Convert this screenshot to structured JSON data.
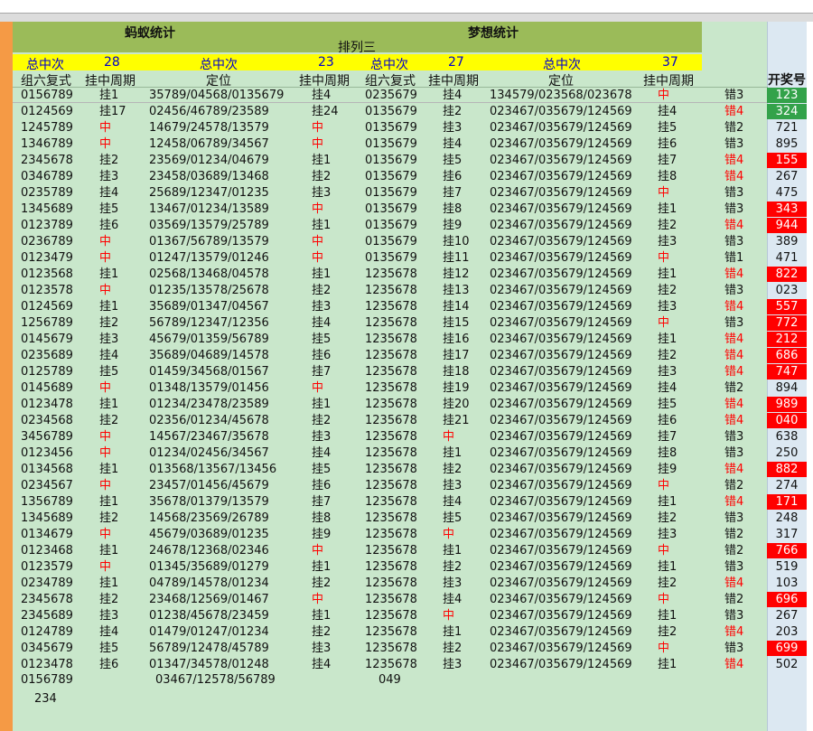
{
  "header": {
    "title_left": "蚂蚁统计",
    "title_right": "梦想统计",
    "subtitle": "排列三",
    "yellow": [
      "总中次",
      "28",
      "总中次",
      "23",
      "总中次",
      "27",
      "总中次",
      "37"
    ],
    "cols": [
      "组六复式",
      "挂中周期",
      "定位",
      "挂中周期",
      "组六复式",
      "挂中周期",
      "定位",
      "挂中周期"
    ],
    "award_header": "开奖号"
  },
  "rows": [
    {
      "a1": "0156789",
      "a2": "挂1",
      "a3": "35789/04568/0135679",
      "b0": "挂4",
      "b1": "0235679",
      "b2": "挂4",
      "b3": "134579/023568/023678",
      "b4": "中",
      "e": "错3",
      "aw": "123",
      "awc": "green"
    },
    {
      "a1": "0124569",
      "a2": "挂17",
      "a3": "02456/46789/23589",
      "b0": "挂24",
      "b1": "0135679",
      "b2": "挂2",
      "b3": "023467/035679/124569",
      "b4": "挂4",
      "e": "错4",
      "aw": "324",
      "awc": "green"
    },
    {
      "a1": "1245789",
      "a2": "中",
      "a3": "14679/24578/13579",
      "b0": "中",
      "b1": "0135679",
      "b2": "挂3",
      "b3": "023467/035679/124569",
      "b4": "挂5",
      "e": "错2",
      "aw": "721",
      "awc": ""
    },
    {
      "a1": "1346789",
      "a2": "中",
      "a3": "12458/06789/34567",
      "b0": "中",
      "b1": "0135679",
      "b2": "挂4",
      "b3": "023467/035679/124569",
      "b4": "挂6",
      "e": "错3",
      "aw": "895",
      "awc": ""
    },
    {
      "a1": "2345678",
      "a2": "挂2",
      "a3": "23569/01234/04679",
      "b0": "挂1",
      "b1": "0135679",
      "b2": "挂5",
      "b3": "023467/035679/124569",
      "b4": "挂7",
      "e": "错4",
      "aw": "155",
      "awc": "red"
    },
    {
      "a1": "0346789",
      "a2": "挂3",
      "a3": "23458/03689/13468",
      "b0": "挂2",
      "b1": "0135679",
      "b2": "挂6",
      "b3": "023467/035679/124569",
      "b4": "挂8",
      "e": "错4",
      "aw": "267",
      "awc": ""
    },
    {
      "a1": "0235789",
      "a2": "挂4",
      "a3": "25689/12347/01235",
      "b0": "挂3",
      "b1": "0135679",
      "b2": "挂7",
      "b3": "023467/035679/124569",
      "b4": "中",
      "e": "错3",
      "aw": "475",
      "awc": ""
    },
    {
      "a1": "1345689",
      "a2": "挂5",
      "a3": "13467/01234/13589",
      "b0": "中",
      "b1": "0135679",
      "b2": "挂8",
      "b3": "023467/035679/124569",
      "b4": "挂1",
      "e": "错3",
      "aw": "343",
      "awc": "red"
    },
    {
      "a1": "0123789",
      "a2": "挂6",
      "a3": "03569/13579/25789",
      "b0": "挂1",
      "b1": "0135679",
      "b2": "挂9",
      "b3": "023467/035679/124569",
      "b4": "挂2",
      "e": "错4",
      "aw": "944",
      "awc": "red"
    },
    {
      "a1": "0236789",
      "a2": "中",
      "a3": "01367/56789/13579",
      "b0": "中",
      "b1": "0135679",
      "b2": "挂10",
      "b3": "023467/035679/124569",
      "b4": "挂3",
      "e": "错3",
      "aw": "389",
      "awc": ""
    },
    {
      "a1": "0123479",
      "a2": "中",
      "a3": "01247/13579/01246",
      "b0": "中",
      "b1": "0135679",
      "b2": "挂11",
      "b3": "023467/035679/124569",
      "b4": "中",
      "e": "错1",
      "aw": "471",
      "awc": ""
    },
    {
      "a1": "0123568",
      "a2": "挂1",
      "a3": "02568/13468/04578",
      "b0": "挂1",
      "b1": "1235678",
      "b2": "挂12",
      "b3": "023467/035679/124569",
      "b4": "挂1",
      "e": "错4",
      "aw": "822",
      "awc": "red"
    },
    {
      "a1": "0123578",
      "a2": "中",
      "a3": "01235/13578/25678",
      "b0": "挂2",
      "b1": "1235678",
      "b2": "挂13",
      "b3": "023467/035679/124569",
      "b4": "挂2",
      "e": "错3",
      "aw": "023",
      "awc": ""
    },
    {
      "a1": "0124569",
      "a2": "挂1",
      "a3": "35689/01347/04567",
      "b0": "挂3",
      "b1": "1235678",
      "b2": "挂14",
      "b3": "023467/035679/124569",
      "b4": "挂3",
      "e": "错4",
      "aw": "557",
      "awc": "red"
    },
    {
      "a1": "1256789",
      "a2": "挂2",
      "a3": "56789/12347/12356",
      "b0": "挂4",
      "b1": "1235678",
      "b2": "挂15",
      "b3": "023467/035679/124569",
      "b4": "中",
      "e": "错3",
      "aw": "772",
      "awc": "red"
    },
    {
      "a1": "0145679",
      "a2": "挂3",
      "a3": "45679/01359/56789",
      "b0": "挂5",
      "b1": "1235678",
      "b2": "挂16",
      "b3": "023467/035679/124569",
      "b4": "挂1",
      "e": "错4",
      "aw": "212",
      "awc": "red"
    },
    {
      "a1": "0235689",
      "a2": "挂4",
      "a3": "35689/04689/14578",
      "b0": "挂6",
      "b1": "1235678",
      "b2": "挂17",
      "b3": "023467/035679/124569",
      "b4": "挂2",
      "e": "错4",
      "aw": "686",
      "awc": "red"
    },
    {
      "a1": "0125789",
      "a2": "挂5",
      "a3": "01459/34568/01567",
      "b0": "挂7",
      "b1": "1235678",
      "b2": "挂18",
      "b3": "023467/035679/124569",
      "b4": "挂3",
      "e": "错4",
      "aw": "747",
      "awc": "red"
    },
    {
      "a1": "0145689",
      "a2": "中",
      "a3": "01348/13579/01456",
      "b0": "中",
      "b1": "1235678",
      "b2": "挂19",
      "b3": "023467/035679/124569",
      "b4": "挂4",
      "e": "错2",
      "aw": "894",
      "awc": ""
    },
    {
      "a1": "0123478",
      "a2": "挂1",
      "a3": "01234/23478/23589",
      "b0": "挂1",
      "b1": "1235678",
      "b2": "挂20",
      "b3": "023467/035679/124569",
      "b4": "挂5",
      "e": "错4",
      "aw": "989",
      "awc": "red"
    },
    {
      "a1": "0234568",
      "a2": "挂2",
      "a3": "02356/01234/45678",
      "b0": "挂2",
      "b1": "1235678",
      "b2": "挂21",
      "b3": "023467/035679/124569",
      "b4": "挂6",
      "e": "错4",
      "aw": "040",
      "awc": "red"
    },
    {
      "a1": "3456789",
      "a2": "中",
      "a3": "14567/23467/35678",
      "b0": "挂3",
      "b1": "1235678",
      "b2": "中",
      "b3": "023467/035679/124569",
      "b4": "挂7",
      "e": "错3",
      "aw": "638",
      "awc": ""
    },
    {
      "a1": "0123456",
      "a2": "中",
      "a3": "01234/02456/34567",
      "b0": "挂4",
      "b1": "1235678",
      "b2": "挂1",
      "b3": "023467/035679/124569",
      "b4": "挂8",
      "e": "错3",
      "aw": "250",
      "awc": ""
    },
    {
      "a1": "0134568",
      "a2": "挂1",
      "a3": "013568/13567/13456",
      "b0": "挂5",
      "b1": "1235678",
      "b2": "挂2",
      "b3": "023467/035679/124569",
      "b4": "挂9",
      "e": "错4",
      "aw": "882",
      "awc": "red"
    },
    {
      "a1": "0234567",
      "a2": "中",
      "a3": "23457/01456/45679",
      "b0": "挂6",
      "b1": "1235678",
      "b2": "挂3",
      "b3": "023467/035679/124569",
      "b4": "中",
      "e": "错2",
      "aw": "274",
      "awc": ""
    },
    {
      "a1": "1356789",
      "a2": "挂1",
      "a3": "35678/01379/13579",
      "b0": "挂7",
      "b1": "1235678",
      "b2": "挂4",
      "b3": "023467/035679/124569",
      "b4": "挂1",
      "e": "错4",
      "aw": "171",
      "awc": "red"
    },
    {
      "a1": "1345689",
      "a2": "挂2",
      "a3": "14568/23569/26789",
      "b0": "挂8",
      "b1": "1235678",
      "b2": "挂5",
      "b3": "023467/035679/124569",
      "b4": "挂2",
      "e": "错3",
      "aw": "248",
      "awc": ""
    },
    {
      "a1": "0134679",
      "a2": "中",
      "a3": "45679/03689/01235",
      "b0": "挂9",
      "b1": "1235678",
      "b2": "中",
      "b3": "023467/035679/124569",
      "b4": "挂3",
      "e": "错2",
      "aw": "317",
      "awc": ""
    },
    {
      "a1": "0123468",
      "a2": "挂1",
      "a3": "24678/12368/02346",
      "b0": "中",
      "b1": "1235678",
      "b2": "挂1",
      "b3": "023467/035679/124569",
      "b4": "中",
      "e": "错2",
      "aw": "766",
      "awc": "red"
    },
    {
      "a1": "0123579",
      "a2": "中",
      "a3": "01345/35689/01279",
      "b0": "挂1",
      "b1": "1235678",
      "b2": "挂2",
      "b3": "023467/035679/124569",
      "b4": "挂1",
      "e": "错3",
      "aw": "519",
      "awc": ""
    },
    {
      "a1": "0234789",
      "a2": "挂1",
      "a3": "04789/14578/01234",
      "b0": "挂2",
      "b1": "1235678",
      "b2": "挂3",
      "b3": "023467/035679/124569",
      "b4": "挂2",
      "e": "错4",
      "aw": "103",
      "awc": ""
    },
    {
      "a1": "2345678",
      "a2": "挂2",
      "a3": "23468/12569/01467",
      "b0": "中",
      "b1": "1235678",
      "b2": "挂4",
      "b3": "023467/035679/124569",
      "b4": "中",
      "e": "错2",
      "aw": "696",
      "awc": "red"
    },
    {
      "a1": "2345689",
      "a2": "挂3",
      "a3": "01238/45678/23459",
      "b0": "挂1",
      "b1": "1235678",
      "b2": "中",
      "b3": "023467/035679/124569",
      "b4": "挂1",
      "e": "错3",
      "aw": "267",
      "awc": ""
    },
    {
      "a1": "0124789",
      "a2": "挂4",
      "a3": "01479/01247/01234",
      "b0": "挂2",
      "b1": "1235678",
      "b2": "挂1",
      "b3": "023467/035679/124569",
      "b4": "挂2",
      "e": "错4",
      "aw": "203",
      "awc": ""
    },
    {
      "a1": "0345679",
      "a2": "挂5",
      "a3": "56789/12478/45789",
      "b0": "挂3",
      "b1": "1235678",
      "b2": "挂2",
      "b3": "023467/035679/124569",
      "b4": "中",
      "e": "错3",
      "aw": "699",
      "awc": "red"
    },
    {
      "a1": "0123478",
      "a2": "挂6",
      "a3": "01347/34578/01248",
      "b0": "挂4",
      "b1": "1235678",
      "b2": "挂3",
      "b3": "023467/035679/124569",
      "b4": "挂1",
      "e": "错4",
      "aw": "502",
      "awc": ""
    }
  ],
  "tail": {
    "a1": "0156789",
    "a3": "03467/12578/56789",
    "b1": "049",
    "last": "234"
  },
  "colors": {
    "red_cell": "#ff0000",
    "green_cell": "#33a24a",
    "title_bar": "#9bbb59",
    "yellow_bar": "#ffff00",
    "sheet_bg": "#c9e7cb",
    "side_strip": "#f59a45"
  }
}
